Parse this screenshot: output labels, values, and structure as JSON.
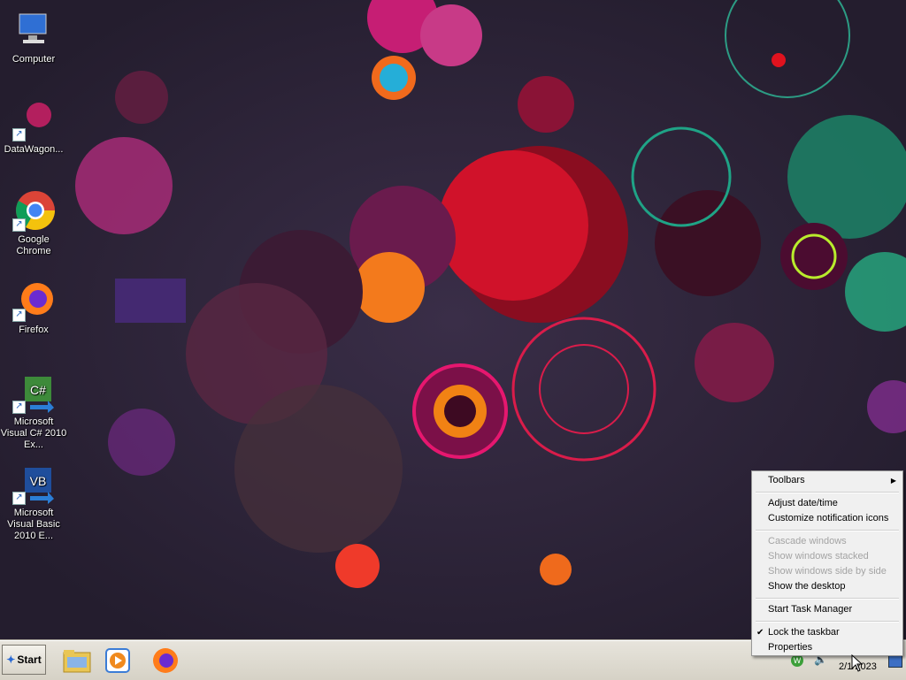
{
  "desktop": {
    "icons": [
      {
        "label": "Computer",
        "icon": "computer-icon"
      },
      {
        "label": "DataWagon...",
        "icon": "datawagon-icon"
      },
      {
        "label": "Google Chrome",
        "icon": "chrome-icon"
      },
      {
        "label": "Firefox",
        "icon": "firefox-icon"
      },
      {
        "label": "Microsoft Visual C# 2010 Ex...",
        "icon": "visual-csharp-icon"
      },
      {
        "label": "Microsoft Visual Basic 2010 E...",
        "icon": "visual-basic-icon"
      }
    ]
  },
  "taskbar": {
    "start_label": "Start",
    "pinned": [
      "file-explorer-icon",
      "media-player-icon",
      "firefox-icon"
    ],
    "clock": "2/1/2023"
  },
  "context_menu": {
    "toolbars": "Toolbars",
    "adjust_datetime": "Adjust date/time",
    "customize_notification": "Customize notification icons",
    "cascade": "Cascade windows",
    "stacked": "Show windows stacked",
    "side_by_side": "Show windows side by side",
    "show_desktop": "Show the desktop",
    "task_manager": "Start Task Manager",
    "lock_taskbar": "Lock the taskbar",
    "properties": "Properties"
  },
  "colors": {
    "wallpaper_bg": "#2a2336",
    "menu_bg": "#f0f0f0",
    "disabled_text": "#a3a3a3"
  }
}
